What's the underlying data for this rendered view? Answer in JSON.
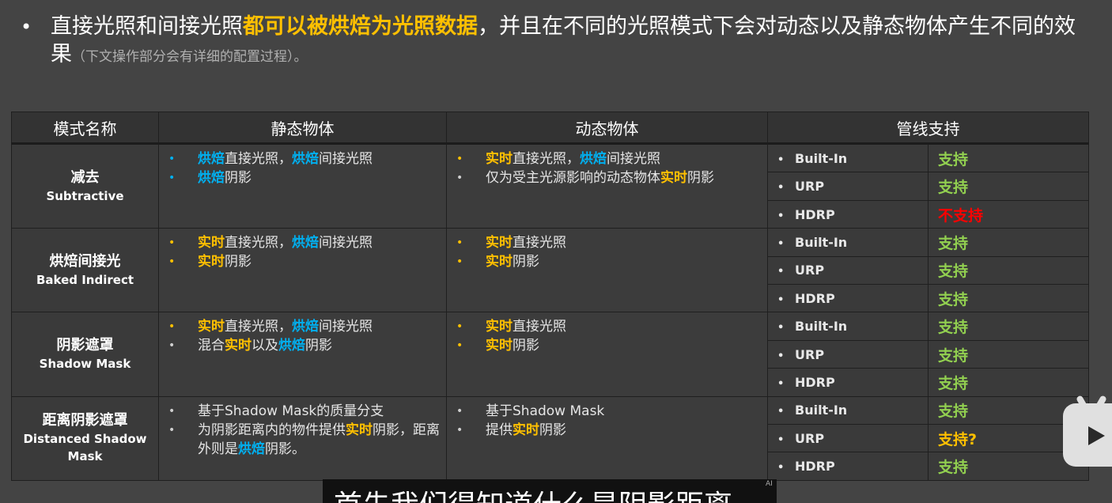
{
  "intro": {
    "bullet": "•",
    "t1": "直接光照和间接光照",
    "hl": "都可以被烘焙为光照数据",
    "t2": "，并且在不同的光照模式下会对动态以及静态物体产生不同的效果",
    "note": "（下文操作部分会有详细的配置过程）。"
  },
  "table": {
    "headers": [
      "模式名称",
      "静态物体",
      "动态物体",
      "管线支持"
    ],
    "rows": [
      {
        "name_cn": "减去",
        "name_en": "Subtractive",
        "static": [
          {
            "bullet_color": "blue",
            "parts": [
              [
                "烘焙",
                "blue"
              ],
              [
                "直接光照，",
                ""
              ],
              [
                "烘焙",
                "blue"
              ],
              [
                "间接光照",
                ""
              ]
            ]
          },
          {
            "bullet_color": "blue",
            "parts": [
              [
                "烘焙",
                "blue"
              ],
              [
                "阴影",
                ""
              ]
            ]
          }
        ],
        "dynamic": [
          {
            "bullet_color": "yellow",
            "parts": [
              [
                "实时",
                "yellow"
              ],
              [
                "直接光照，",
                ""
              ],
              [
                "烘焙",
                "blue"
              ],
              [
                "间接光照",
                ""
              ]
            ]
          },
          {
            "bullet_color": "gray",
            "parts": [
              [
                "仅为受主光源影响的动态物体",
                ""
              ],
              [
                "实时",
                "yellow"
              ],
              [
                "阴影",
                ""
              ]
            ]
          }
        ],
        "pipelines": [
          {
            "name": "Built-In",
            "support": "支持",
            "status": "green"
          },
          {
            "name": "URP",
            "support": "支持",
            "status": "green"
          },
          {
            "name": "HDRP",
            "support": "不支持",
            "status": "red"
          }
        ]
      },
      {
        "name_cn": "烘焙间接光",
        "name_en": "Baked Indirect",
        "static": [
          {
            "bullet_color": "yellow",
            "parts": [
              [
                "实时",
                "yellow"
              ],
              [
                "直接光照，",
                ""
              ],
              [
                "烘焙",
                "blue"
              ],
              [
                "间接光照",
                ""
              ]
            ]
          },
          {
            "bullet_color": "yellow",
            "parts": [
              [
                "实时",
                "yellow"
              ],
              [
                "阴影",
                ""
              ]
            ]
          }
        ],
        "dynamic": [
          {
            "bullet_color": "yellow",
            "parts": [
              [
                "实时",
                "yellow"
              ],
              [
                "直接光照",
                ""
              ]
            ]
          },
          {
            "bullet_color": "yellow",
            "parts": [
              [
                "实时",
                "yellow"
              ],
              [
                "阴影",
                ""
              ]
            ]
          }
        ],
        "pipelines": [
          {
            "name": "Built-In",
            "support": "支持",
            "status": "green"
          },
          {
            "name": "URP",
            "support": "支持",
            "status": "green"
          },
          {
            "name": "HDRP",
            "support": "支持",
            "status": "green"
          }
        ]
      },
      {
        "name_cn": "阴影遮罩",
        "name_en": "Shadow Mask",
        "static": [
          {
            "bullet_color": "yellow",
            "parts": [
              [
                "实时",
                "yellow"
              ],
              [
                "直接光照，",
                ""
              ],
              [
                "烘焙",
                "blue"
              ],
              [
                "间接光照",
                ""
              ]
            ]
          },
          {
            "bullet_color": "gray",
            "parts": [
              [
                "混合",
                ""
              ],
              [
                "实时",
                "yellow"
              ],
              [
                "以及",
                ""
              ],
              [
                "烘焙",
                "blue"
              ],
              [
                "阴影",
                ""
              ]
            ]
          }
        ],
        "dynamic": [
          {
            "bullet_color": "yellow",
            "parts": [
              [
                "实时",
                "yellow"
              ],
              [
                "直接光照",
                ""
              ]
            ]
          },
          {
            "bullet_color": "yellow",
            "parts": [
              [
                "实时",
                "yellow"
              ],
              [
                "阴影",
                ""
              ]
            ]
          }
        ],
        "pipelines": [
          {
            "name": "Built-In",
            "support": "支持",
            "status": "green"
          },
          {
            "name": "URP",
            "support": "支持",
            "status": "green"
          },
          {
            "name": "HDRP",
            "support": "支持",
            "status": "green"
          }
        ]
      },
      {
        "name_cn": "距离阴影遮罩",
        "name_en": "Distanced Shadow Mask",
        "static": [
          {
            "bullet_color": "gray",
            "parts": [
              [
                "基于Shadow Mask的质量分支",
                ""
              ]
            ]
          },
          {
            "bullet_color": "gray",
            "parts": [
              [
                "为阴影距离内的物件提供",
                ""
              ],
              [
                "实时",
                "yellow"
              ],
              [
                "阴影，距离外则是",
                ""
              ],
              [
                "烘焙",
                "blue"
              ],
              [
                "阴影。",
                ""
              ]
            ]
          }
        ],
        "dynamic": [
          {
            "bullet_color": "gray",
            "parts": [
              [
                "基于Shadow Mask",
                ""
              ]
            ]
          },
          {
            "bullet_color": "gray",
            "parts": [
              [
                "提供",
                ""
              ],
              [
                "实时",
                "yellow"
              ],
              [
                "阴影",
                ""
              ]
            ]
          }
        ],
        "pipelines": [
          {
            "name": "Built-In",
            "support": "支持",
            "status": "green"
          },
          {
            "name": "URP",
            "support": "支持?",
            "status": "yellow"
          },
          {
            "name": "HDRP",
            "support": "支持",
            "status": "green"
          }
        ]
      }
    ]
  },
  "subtitle": "首先我们得知道什么是阴影距离",
  "ai_badge": "AI",
  "pipe_bullet": "•",
  "icons": {
    "player": "bilibili-tv-play-icon"
  }
}
